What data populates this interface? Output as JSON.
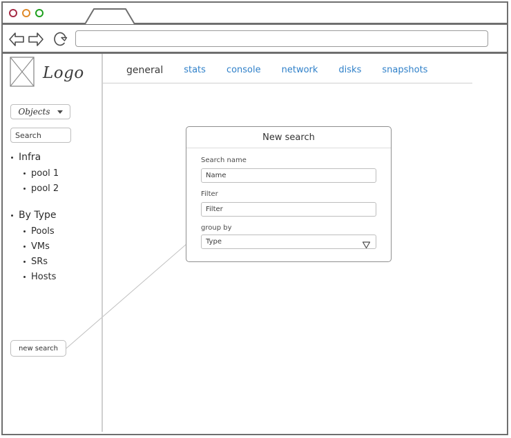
{
  "browser": {
    "traffic_lights": [
      {
        "name": "close",
        "color": "#a62b45"
      },
      {
        "name": "minimize",
        "color": "#e08a28"
      },
      {
        "name": "maximize",
        "color": "#1ea01e"
      }
    ],
    "tab_label": "",
    "back_icon": "back-arrow-icon",
    "forward_icon": "forward-arrow-icon",
    "reload_icon": "reload-icon",
    "url_value": "",
    "url_placeholder": ""
  },
  "sidebar": {
    "logo_text": "Logo",
    "logo_placeholder_icon": "image-placeholder-icon",
    "objects_dropdown": {
      "label": "Objects",
      "caret_icon": "caret-down-icon"
    },
    "search": {
      "value": "",
      "placeholder": "Search"
    },
    "tree": [
      {
        "label": "Infra",
        "children": [
          {
            "label": "pool 1"
          },
          {
            "label": "pool 2"
          }
        ]
      },
      {
        "label": "By Type",
        "children": [
          {
            "label": "Pools"
          },
          {
            "label": "VMs"
          },
          {
            "label": "SRs"
          },
          {
            "label": "Hosts"
          }
        ]
      }
    ],
    "new_search_button": "new search"
  },
  "main": {
    "tabs": [
      {
        "label": "general",
        "active": true
      },
      {
        "label": "stats",
        "active": false
      },
      {
        "label": "console",
        "active": false
      },
      {
        "label": "network",
        "active": false
      },
      {
        "label": "disks",
        "active": false
      },
      {
        "label": "snapshots",
        "active": false
      }
    ]
  },
  "dialog": {
    "title": "New search",
    "fields": {
      "search_name": {
        "label": "Search name",
        "value": "",
        "placeholder": "Name"
      },
      "filter": {
        "label": "Filter",
        "value": "",
        "placeholder": "Filter"
      },
      "group_by": {
        "label": "group by",
        "selected": "Type",
        "chevron_icon": "triangle-down-icon"
      }
    }
  },
  "colors": {
    "link_blue": "#2f80c9",
    "frame_gray": "#6e6e6e",
    "border_gray": "#bdbdbd"
  }
}
